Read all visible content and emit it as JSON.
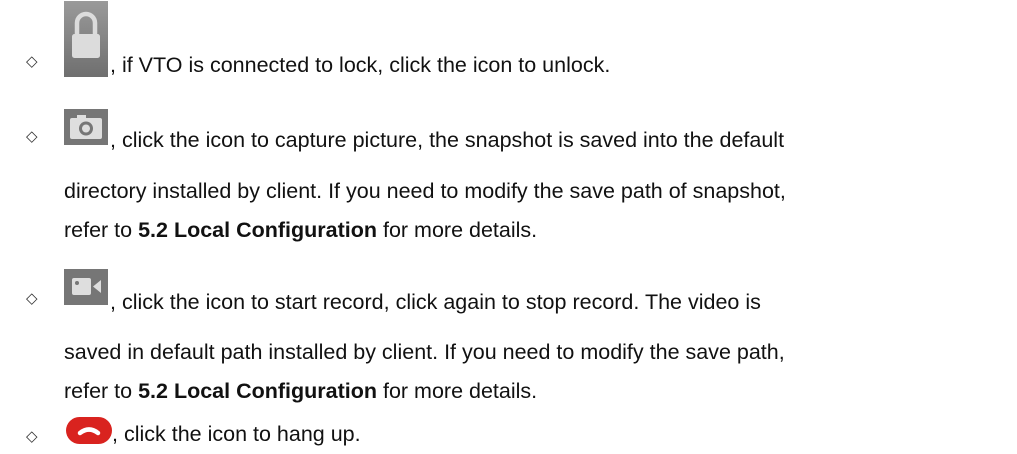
{
  "bullet_glyph": "◇",
  "items": [
    {
      "icon": "lock-icon",
      "text": ", if VTO is connected to lock, click the icon to unlock."
    },
    {
      "icon": "camera-icon",
      "text": ", click the icon to capture picture, the snapshot is saved into the default",
      "line2": "directory installed by client. If you need to modify the save path of snapshot,",
      "line3_prefix": "refer to ",
      "line3_bold": "5.2 Local Configuration",
      "line3_suffix": " for more details."
    },
    {
      "icon": "video-record-icon",
      "text": ", click the icon to start record, click again to stop record. The video is",
      "line2": "saved in default path installed by client. If you need to modify the save path,",
      "line3_prefix": "refer to ",
      "line3_bold": "5.2 Local Configuration",
      "line3_suffix": " for more details."
    },
    {
      "icon": "hang-up-icon",
      "text": ", click the icon to hang up."
    }
  ],
  "colors": {
    "icon_gray": "#7a7a7a",
    "icon_light": "#d6d6d6",
    "hangup_red": "#d9231f"
  }
}
